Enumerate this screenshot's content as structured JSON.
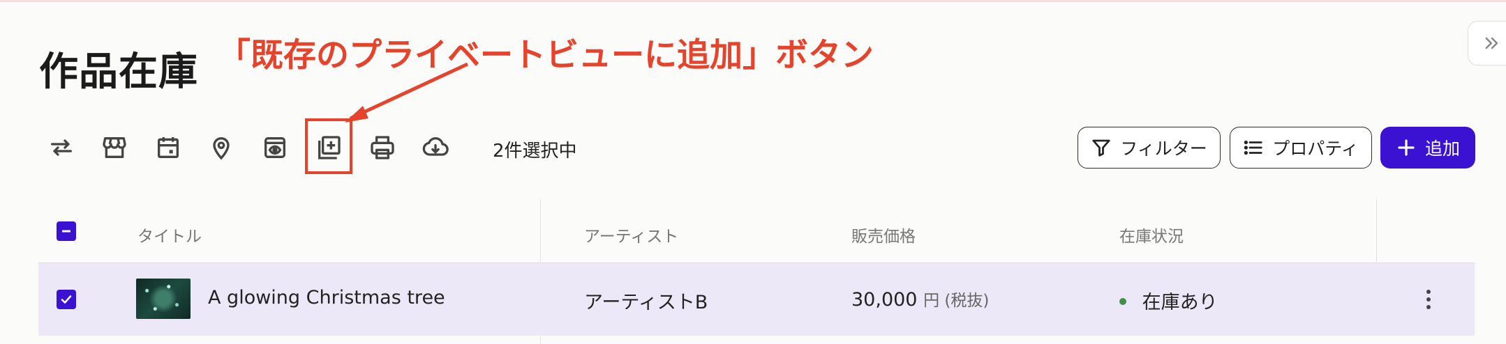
{
  "page": {
    "title": "作品在庫"
  },
  "annotation": {
    "text": "「既存のプライベートビューに追加」ボタン",
    "color": "#e5432b"
  },
  "toolbar": {
    "icons": [
      "swap-icon",
      "store-icon",
      "calendar-icon",
      "location-pin-icon",
      "private-view-icon",
      "add-to-private-view-icon",
      "print-icon",
      "cloud-download-icon"
    ],
    "selection_count": "2件選択中",
    "filter_label": "フィルター",
    "properties_label": "プロパティ",
    "add_label": "追加"
  },
  "table": {
    "headers": {
      "title": "タイトル",
      "artist": "アーティスト",
      "price": "販売価格",
      "status": "在庫状況"
    },
    "rows": [
      {
        "selected": true,
        "title": "A glowing Christmas tree",
        "artist": "アーティストB",
        "price": "30,000",
        "price_unit": "円 (税抜)",
        "status": "在庫あり",
        "status_color": "#3f8f4a"
      }
    ]
  },
  "colors": {
    "accent": "#3b12d1",
    "row_selected_bg": "#ece8f7"
  }
}
